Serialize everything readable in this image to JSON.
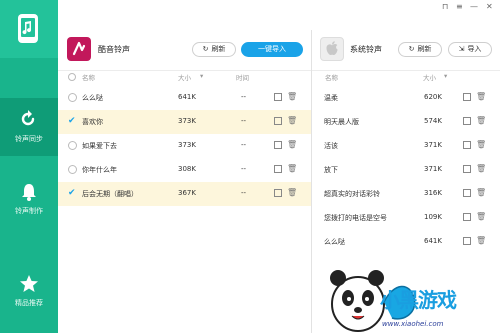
{
  "window": {
    "icons": [
      "skin-icon",
      "menu-icon",
      "minimize-icon",
      "close-icon"
    ],
    "glyphs": [
      "⊓",
      "≡",
      "—",
      "✕"
    ]
  },
  "sidebar": {
    "items": [
      {
        "label": "铃声同步",
        "icon": "sync-icon",
        "active": true
      },
      {
        "label": "铃声制作",
        "icon": "bell-icon",
        "active": false
      },
      {
        "label": "精品推荐",
        "icon": "star-icon",
        "active": false
      }
    ]
  },
  "left_panel": {
    "title": "酷音铃声",
    "refresh_label": "刷新",
    "import_label": "一键导入",
    "columns": {
      "name": "名称",
      "size": "大小",
      "duration": "时间"
    },
    "rows": [
      {
        "name": "么么哒",
        "size": "641K",
        "duration": "--",
        "checked": false
      },
      {
        "name": "喜欢你",
        "size": "373K",
        "duration": "--",
        "checked": true
      },
      {
        "name": "如果爱下去",
        "size": "373K",
        "duration": "--",
        "checked": false
      },
      {
        "name": "你年什么年",
        "size": "308K",
        "duration": "--",
        "checked": false
      },
      {
        "name": "后会无期（翻唱）",
        "size": "367K",
        "duration": "--",
        "checked": true
      }
    ]
  },
  "right_panel": {
    "title": "系统铃声",
    "refresh_label": "刷新",
    "import_label": "导入",
    "columns": {
      "name": "名称",
      "size": "大小"
    },
    "rows": [
      {
        "name": "温柔",
        "size": "620K"
      },
      {
        "name": "明天晨人版",
        "size": "574K"
      },
      {
        "name": "活该",
        "size": "371K"
      },
      {
        "name": "放下",
        "size": "371K"
      },
      {
        "name": "超真实的对话彩铃",
        "size": "316K"
      },
      {
        "name": "您拨打的电话是空号",
        "size": "109K"
      },
      {
        "name": "么么哒",
        "size": "641K"
      }
    ]
  },
  "watermark": {
    "brand": "小黑游戏",
    "url": "www.xiaohei.com"
  },
  "colors": {
    "sidebar": "#19b48c",
    "accent": "#1aa3e8",
    "selected_row": "#fdf6dc",
    "app_icon": "#c2185b"
  }
}
